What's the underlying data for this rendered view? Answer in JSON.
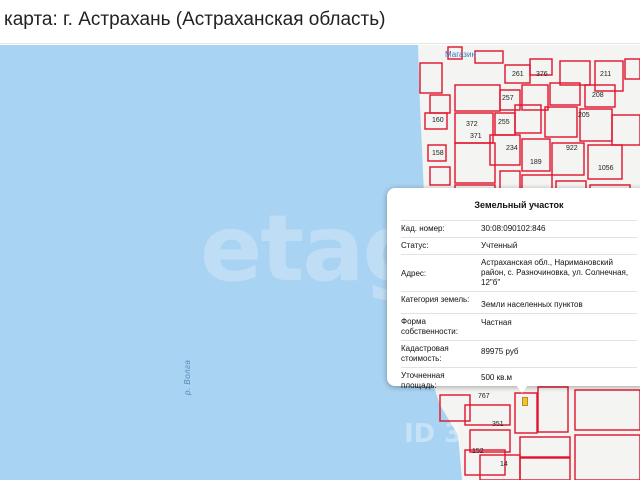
{
  "header": {
    "title": "карта: г. Астрахань (Астраханская область)"
  },
  "map": {
    "river_label": "р. Волга",
    "watermark": "etagi",
    "watermark_id": "ID 3",
    "poi_label": "Магазин",
    "parcel_numbers": [
      "261",
      "376",
      "211",
      "257",
      "208",
      "160",
      "372",
      "371",
      "255",
      "205",
      "158",
      "234",
      "189",
      "922",
      "1056",
      "767",
      "351",
      "152",
      "14"
    ],
    "colors": {
      "water": "#a9d3f2",
      "land": "#f4f4f2",
      "parcel_border": "#e1122a",
      "popup_bg": "#ffffff"
    }
  },
  "popup": {
    "title": "Земельный участок",
    "rows": [
      {
        "key": "Кад. номер:",
        "value": "30:08:090102:846"
      },
      {
        "key": "Статус:",
        "value": "Учтенный"
      },
      {
        "key": "Адрес:",
        "value": "Астраханская обл., Наримановский район, с. Разночиновка, ул. Солнечная, 12\"б\""
      },
      {
        "key": "Категория земель:",
        "value": "Земли населенных пунктов"
      },
      {
        "key": "Форма собственности:",
        "value": "Частная"
      },
      {
        "key": "Кадастровая стоимость:",
        "value": "89975 руб"
      },
      {
        "key": "Уточненная площадь:",
        "value": "500 кв.м"
      }
    ]
  }
}
